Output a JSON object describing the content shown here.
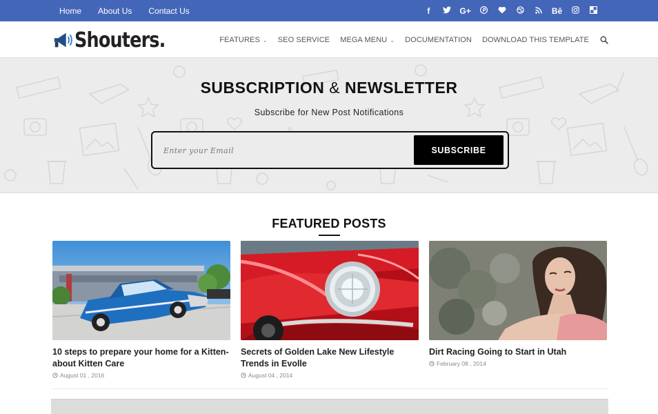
{
  "topbar": {
    "links": [
      "Home",
      "About Us",
      "Contact Us"
    ],
    "social_icons": [
      {
        "name": "facebook-icon",
        "glyph": "f"
      },
      {
        "name": "twitter-icon",
        "glyph": "🐦"
      },
      {
        "name": "google-plus-icon",
        "glyph": "G+"
      },
      {
        "name": "pinterest-icon",
        "glyph": "℗"
      },
      {
        "name": "heart-icon",
        "glyph": "♥"
      },
      {
        "name": "dribbble-icon",
        "glyph": "◍"
      },
      {
        "name": "rss-icon",
        "glyph": "≋"
      },
      {
        "name": "behance-icon",
        "glyph": "Bē"
      },
      {
        "name": "instagram-icon",
        "glyph": "◙"
      },
      {
        "name": "delicious-icon",
        "glyph": "◧"
      }
    ],
    "bg_color": "#4466b8"
  },
  "header": {
    "logo_text": "Shouters.",
    "nav": [
      "FEATURES",
      "SEO SERVICE",
      "MEGA MENU",
      "DOCUMENTATION",
      "DOWNLOAD THIS TEMPLATE"
    ],
    "dropdown_items": [
      "FEATURES",
      "MEGA MENU"
    ]
  },
  "subscribe": {
    "title_left": "SUBSCRIPTION",
    "title_amp": "&",
    "title_right": "NEWSLETTER",
    "subtitle": "Subscribe for New Post Notifications",
    "email_placeholder": "Enter your Email",
    "button_label": "SUBSCRIBE"
  },
  "featured": {
    "heading": "FEATURED POSTS",
    "posts": [
      {
        "title": "10 steps to prepare your home for a Kitten-about Kitten Care",
        "date": "August 01 , 2016"
      },
      {
        "title": "Secrets of Golden Lake New Lifestyle Trends in Evolle",
        "date": "August 04 , 2014"
      },
      {
        "title": "Dirt Racing Going to Start in Utah",
        "date": "February 08 , 2014"
      }
    ]
  }
}
